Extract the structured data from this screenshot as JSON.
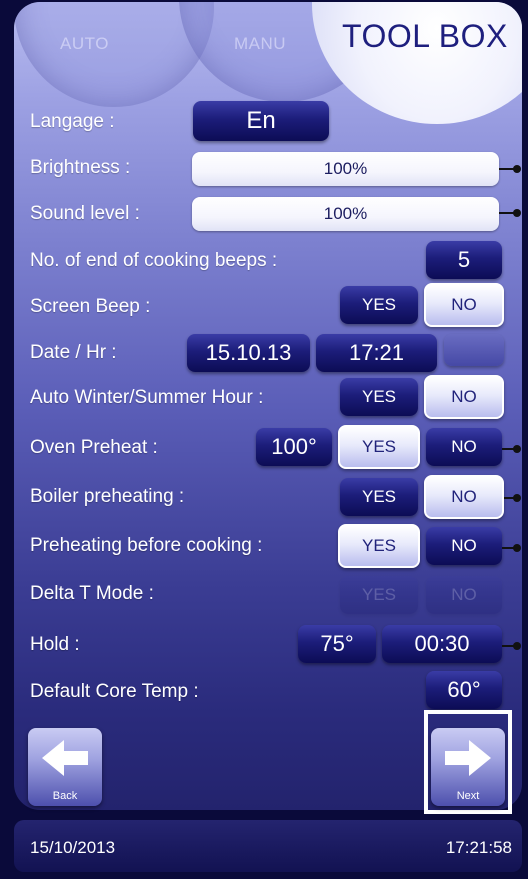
{
  "tabs": [
    {
      "label": "AUTO"
    },
    {
      "label": "MANU"
    },
    {
      "label": "TOOL BOX"
    }
  ],
  "settings": {
    "language": {
      "label": "Langage :",
      "value": "En"
    },
    "brightness": {
      "label": "Brightness :",
      "value": "100%",
      "level_percent": 100
    },
    "sound": {
      "label": "Sound level :",
      "value": "100%",
      "level_percent": 100
    },
    "beeps": {
      "label": "No. of end of cooking beeps :",
      "value": "5"
    },
    "screen_beep": {
      "label": "Screen Beep :",
      "yes": "YES",
      "no": "NO",
      "selected": "NO"
    },
    "date_hr": {
      "label": "Date / Hr :",
      "date": "15.10.13",
      "time": "17:21"
    },
    "auto_winter_summer": {
      "label": "Auto Winter/Summer Hour :",
      "yes": "YES",
      "no": "NO",
      "selected": "NO"
    },
    "oven_preheat": {
      "label": "Oven Preheat :",
      "temp": "100°",
      "yes": "YES",
      "no": "NO",
      "selected": "YES"
    },
    "boiler_preheating": {
      "label": "Boiler preheating :",
      "yes": "YES",
      "no": "NO",
      "selected": "NO"
    },
    "preheating_before_cooking": {
      "label": "Preheating before cooking :",
      "yes": "YES",
      "no": "NO",
      "selected": "YES"
    },
    "delta_t_mode": {
      "label": "Delta T Mode :",
      "yes": "YES",
      "no": "NO",
      "enabled": false
    },
    "hold": {
      "label": "Hold :",
      "temp": "75°",
      "time": "00:30"
    },
    "default_core_temp": {
      "label": "Default Core Temp :",
      "value": "60°"
    }
  },
  "nav": {
    "back": "Back",
    "next": "Next"
  },
  "footer": {
    "date": "15/10/2013",
    "time": "17:21:58"
  },
  "colors": {
    "title": "#1e1f7e",
    "selected_button": "#ffffff",
    "unselected_button": "#0c0c55"
  }
}
